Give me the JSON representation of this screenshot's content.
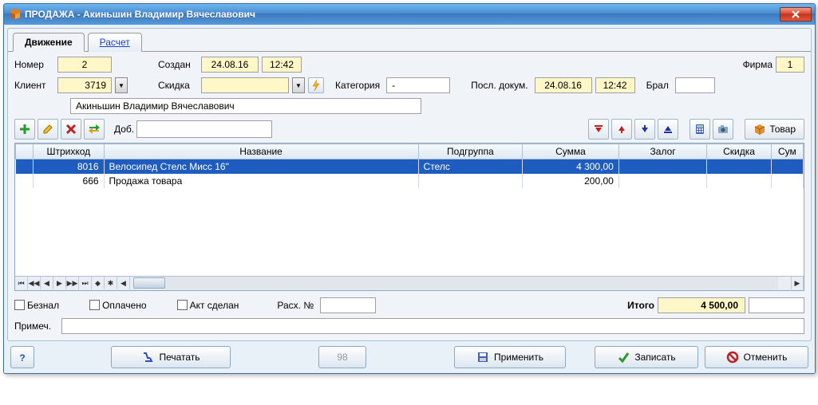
{
  "window": {
    "title": "ПРОДАЖА - Акиньшин Владимир Вячеславович"
  },
  "tabs": {
    "movement": "Движение",
    "calc": "Расчет"
  },
  "labels": {
    "number": "Номер",
    "created": "Создан",
    "firm": "Фирма",
    "client": "Клиент",
    "discount": "Скидка",
    "category": "Категория",
    "lastdoc": "Посл. докум.",
    "took": "Брал",
    "add": "Доб.",
    "cashless": "Безнал",
    "paid": "Оплачено",
    "act": "Акт сделан",
    "expense": "Расх. №",
    "total": "Итого",
    "note": "Примеч.",
    "goods_btn": "Товар"
  },
  "fields": {
    "number": "2",
    "created_date": "24.08.16",
    "created_time": "12:42",
    "firm": "1",
    "client_code": "3719",
    "category": "-",
    "lastdoc_date": "24.08.16",
    "lastdoc_time": "12:42",
    "client_name": "Акиньшин Владимир Вячеславович",
    "total": "4 500,00"
  },
  "columns": {
    "barcode": "Штрихкод",
    "name": "Название",
    "subgroup": "Подгруппа",
    "sum": "Сумма",
    "deposit": "Залог",
    "discount": "Скидка",
    "sumcut": "Сум"
  },
  "rows": [
    {
      "barcode": "8016",
      "name": "Велосипед Стелс Мисс 16\"",
      "subgroup": "Стелс",
      "sum": "4 300,00",
      "deposit": "",
      "discount": "",
      "selected": true
    },
    {
      "barcode": "666",
      "name": "Продажа товара",
      "subgroup": "",
      "sum": "200,00",
      "deposit": "",
      "discount": "",
      "selected": false
    }
  ],
  "buttons": {
    "print": "Печатать",
    "id": "98",
    "apply": "Применить",
    "save": "Записать",
    "cancel": "Отменить"
  }
}
